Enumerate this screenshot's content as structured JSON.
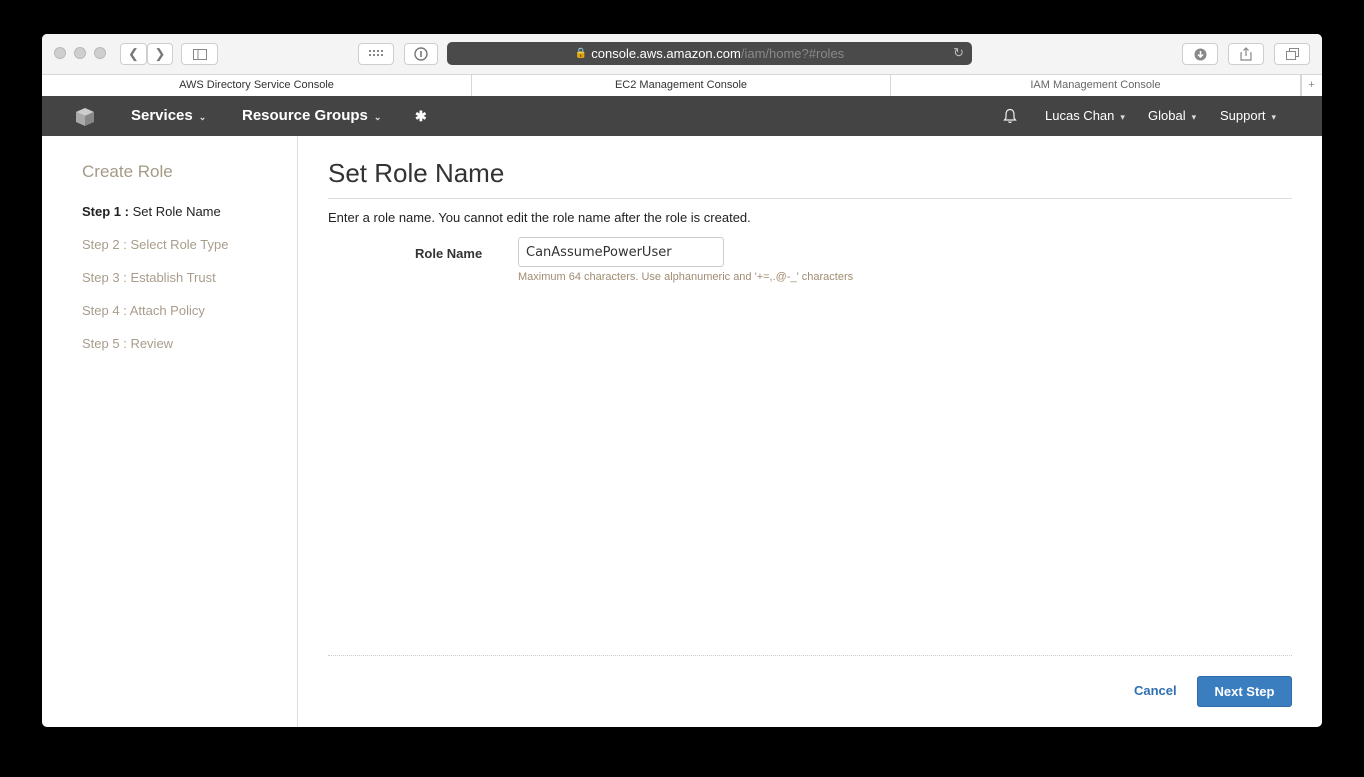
{
  "browser": {
    "url_host": "console.aws.amazon.com",
    "url_path": "/iam/home?#roles",
    "tabs": [
      {
        "label": "AWS Directory Service Console"
      },
      {
        "label": "EC2 Management Console"
      },
      {
        "label": "IAM Management Console"
      }
    ]
  },
  "awsnav": {
    "services": "Services",
    "resource_groups": "Resource Groups",
    "user": "Lucas Chan",
    "region": "Global",
    "support": "Support"
  },
  "sidebar": {
    "title": "Create Role",
    "steps": [
      {
        "prefix": "Step 1 :",
        "label": "Set Role Name"
      },
      {
        "prefix": "Step 2 :",
        "label": "Select Role Type"
      },
      {
        "prefix": "Step 3 :",
        "label": "Establish Trust"
      },
      {
        "prefix": "Step 4 :",
        "label": "Attach Policy"
      },
      {
        "prefix": "Step 5 :",
        "label": "Review"
      }
    ]
  },
  "main": {
    "title": "Set Role Name",
    "description": "Enter a role name. You cannot edit the role name after the role is created.",
    "role_name_label": "Role Name",
    "role_name_value": "CanAssumePowerUser",
    "hint": "Maximum 64 characters. Use alphanumeric and '+=,.@-_' characters",
    "cancel_label": "Cancel",
    "next_label": "Next Step"
  },
  "colors": {
    "nav_bg": "#444444",
    "primary_button": "#3a7ebf",
    "link": "#2f6fb2"
  }
}
